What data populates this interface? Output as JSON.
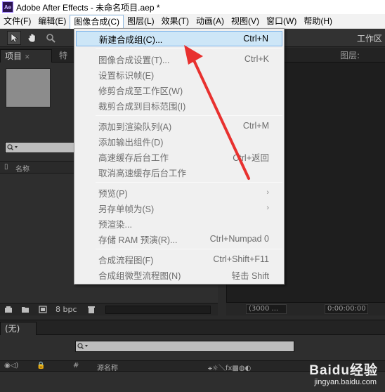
{
  "window": {
    "logo_text": "Ae",
    "title": "Adobe After Effects - 未命名项目.aep *"
  },
  "menubar": {
    "items": [
      {
        "label": "文件(F)"
      },
      {
        "label": "编辑(E)"
      },
      {
        "label": "图像合成(C)",
        "active": true
      },
      {
        "label": "图层(L)"
      },
      {
        "label": "效果(T)"
      },
      {
        "label": "动画(A)"
      },
      {
        "label": "视图(V)"
      },
      {
        "label": "窗口(W)"
      },
      {
        "label": "帮助(H)"
      }
    ]
  },
  "toolbar": {
    "tools": [
      "selection-tool-icon",
      "hand-tool-icon",
      "zoom-tool-icon"
    ],
    "workspace_label": "工作区"
  },
  "panels": {
    "project_tab": "项目",
    "effects_tab": "特效",
    "layer_tab": "图层:（无）",
    "name_column": "名称",
    "bpc_label": "8 bpc",
    "comp_zoom": "(3000 ...",
    "comp_time": "0:00:00:00"
  },
  "timeline": {
    "tab_label": "(无)",
    "source_name_column": "源名称"
  },
  "dropdown": {
    "items": [
      {
        "label": "新建合成组(C)...",
        "shortcut": "Ctrl+N",
        "highlighted": true
      },
      {
        "label": "图像合成设置(T)...",
        "shortcut": "Ctrl+K"
      },
      {
        "label": "设置标识帧(E)",
        "shortcut": ""
      },
      {
        "label": "修剪合成至工作区(W)",
        "shortcut": ""
      },
      {
        "label": "裁剪合成到目标范围(I)",
        "shortcut": ""
      },
      {
        "label": "添加到渲染队列(A)",
        "shortcut": "Ctrl+M"
      },
      {
        "label": "添加输出组件(D)",
        "shortcut": ""
      },
      {
        "label": "高速缓存后台工作",
        "shortcut": "Ctrl+返回"
      },
      {
        "label": "取消高速缓存后台工作",
        "shortcut": ""
      },
      {
        "label": "预览(P)",
        "shortcut": "",
        "submenu": true
      },
      {
        "label": "另存单帧为(S)",
        "shortcut": "",
        "submenu": true
      },
      {
        "label": "预渲染...",
        "shortcut": ""
      },
      {
        "label": "存储 RAM 预演(R)...",
        "shortcut": "Ctrl+Numpad 0"
      },
      {
        "label": "合成流程图(F)",
        "shortcut": "Ctrl+Shift+F11"
      },
      {
        "label": "合成组微型流程图(N)",
        "shortcut": "轻击 Shift"
      }
    ]
  },
  "watermark": {
    "main": "Baidu经验",
    "sub": "jingyan.baidu.com"
  },
  "colors": {
    "arrow": "#e8312f",
    "highlight": "#cde6f7",
    "panel": "#2e2e2e"
  }
}
